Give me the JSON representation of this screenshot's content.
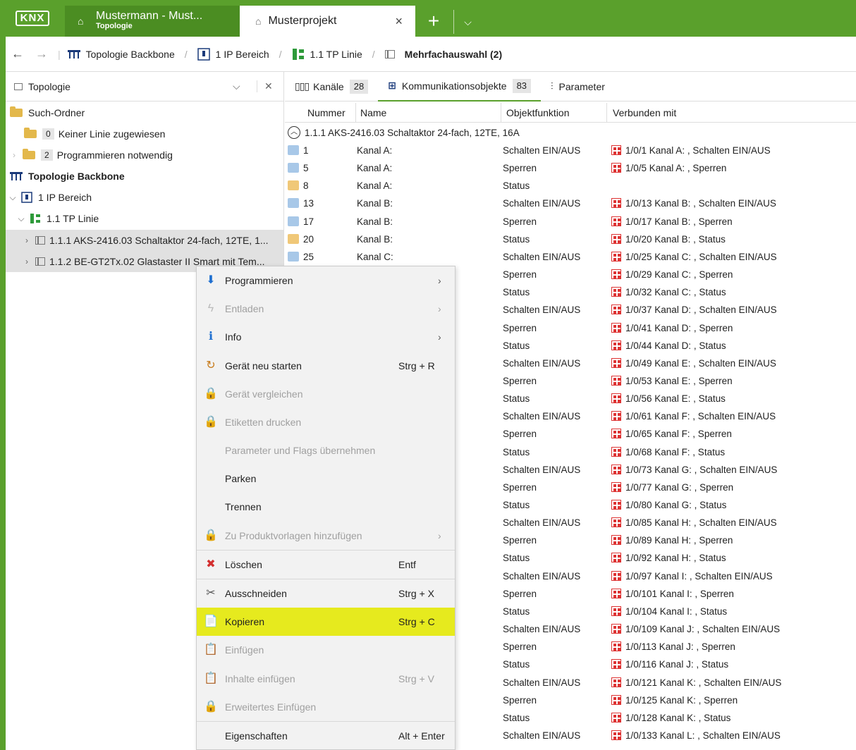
{
  "app": {
    "logo": "KNX",
    "tab1_title": "Mustermann - Must...",
    "tab1_sub": "Topologie",
    "tab2_title": "Musterprojekt",
    "tab2_close": "×",
    "new_tab": "+",
    "dropdown": "⌵"
  },
  "breadcrumb": {
    "back": "←",
    "forward": "→",
    "items": [
      "Topologie Backbone",
      "1 IP Bereich",
      "1.1 TP Linie",
      "Mehrfachauswahl (2)"
    ],
    "separator": "/"
  },
  "left": {
    "header": "Topologie",
    "chevron": "⌵",
    "close": "✕",
    "tree": [
      {
        "label": "Such-Ordner"
      },
      {
        "count": "0",
        "label": "Keiner Linie zugewiesen"
      },
      {
        "count": "2",
        "label": "Programmieren notwendig"
      },
      {
        "label": "Topologie Backbone"
      },
      {
        "label": "1 IP Bereich"
      },
      {
        "label": "1.1 TP Linie"
      },
      {
        "label": "1.1.1 AKS-2416.03 Schaltaktor 24-fach, 12TE, 1..."
      },
      {
        "label": "1.1.2 BE-GT2Tx.02 Glastaster II Smart mit Tem..."
      }
    ]
  },
  "right": {
    "tabs": [
      {
        "label": "Kanäle",
        "count": "28"
      },
      {
        "label": "Kommunikationsobjekte",
        "count": "83"
      },
      {
        "label": "Parameter"
      }
    ],
    "columns": [
      "Nummer",
      "Name",
      "Objektfunktion",
      "Verbunden mit"
    ],
    "group": "1.1.1 AKS-2416.03 Schaltaktor 24-fach, 12TE, 16A",
    "rows": [
      {
        "num": "1",
        "name": "Kanal A:",
        "func": "Schalten EIN/AUS",
        "conn": "1/0/1 Kanal A: , Schalten EIN/AUS"
      },
      {
        "num": "5",
        "name": "Kanal A:",
        "func": "Sperren",
        "conn": "1/0/5 Kanal A: , Sperren"
      },
      {
        "num": "8",
        "name": "Kanal A:",
        "func": "Status",
        "conn": ""
      },
      {
        "num": "13",
        "name": "Kanal B:",
        "func": "Schalten EIN/AUS",
        "conn": "1/0/13 Kanal B: , Schalten EIN/AUS"
      },
      {
        "num": "17",
        "name": "Kanal B:",
        "func": "Sperren",
        "conn": "1/0/17 Kanal B: , Sperren"
      },
      {
        "num": "20",
        "name": "Kanal B:",
        "func": "Status",
        "conn": "1/0/20 Kanal B: , Status"
      },
      {
        "num": "25",
        "name": "Kanal C:",
        "func": "Schalten EIN/AUS",
        "conn": "1/0/25 Kanal C: , Schalten EIN/AUS"
      },
      {
        "num": "",
        "name": "",
        "func": "Sperren",
        "conn": "1/0/29 Kanal C: , Sperren"
      },
      {
        "num": "",
        "name": "",
        "func": "Status",
        "conn": "1/0/32 Kanal C: , Status"
      },
      {
        "num": "",
        "name": "",
        "func": "Schalten EIN/AUS",
        "conn": "1/0/37 Kanal D: , Schalten EIN/AUS"
      },
      {
        "num": "",
        "name": "",
        "func": "Sperren",
        "conn": "1/0/41 Kanal D: , Sperren"
      },
      {
        "num": "",
        "name": "",
        "func": "Status",
        "conn": "1/0/44 Kanal D: , Status"
      },
      {
        "num": "",
        "name": "",
        "func": "Schalten EIN/AUS",
        "conn": "1/0/49 Kanal E: , Schalten EIN/AUS"
      },
      {
        "num": "",
        "name": "",
        "func": "Sperren",
        "conn": "1/0/53 Kanal E: , Sperren"
      },
      {
        "num": "",
        "name": "",
        "func": "Status",
        "conn": "1/0/56 Kanal E: , Status"
      },
      {
        "num": "",
        "name": "",
        "func": "Schalten EIN/AUS",
        "conn": "1/0/61 Kanal F: , Schalten EIN/AUS"
      },
      {
        "num": "",
        "name": "",
        "func": "Sperren",
        "conn": "1/0/65 Kanal F: , Sperren"
      },
      {
        "num": "",
        "name": "",
        "func": "Status",
        "conn": "1/0/68 Kanal F: , Status"
      },
      {
        "num": "",
        "name": "",
        "func": "Schalten EIN/AUS",
        "conn": "1/0/73 Kanal G: , Schalten EIN/AUS"
      },
      {
        "num": "",
        "name": "",
        "func": "Sperren",
        "conn": "1/0/77 Kanal G: , Sperren"
      },
      {
        "num": "",
        "name": "",
        "func": "Status",
        "conn": "1/0/80 Kanal G: , Status"
      },
      {
        "num": "",
        "name": "",
        "func": "Schalten EIN/AUS",
        "conn": "1/0/85 Kanal H: , Schalten EIN/AUS"
      },
      {
        "num": "",
        "name": "",
        "func": "Sperren",
        "conn": "1/0/89 Kanal H: , Sperren"
      },
      {
        "num": "",
        "name": "",
        "func": "Status",
        "conn": "1/0/92 Kanal H: , Status"
      },
      {
        "num": "",
        "name": "",
        "func": "Schalten EIN/AUS",
        "conn": "1/0/97 Kanal I: , Schalten EIN/AUS"
      },
      {
        "num": "",
        "name": "",
        "func": "Sperren",
        "conn": "1/0/101 Kanal I: , Sperren"
      },
      {
        "num": "",
        "name": "",
        "func": "Status",
        "conn": "1/0/104 Kanal I: , Status"
      },
      {
        "num": "",
        "name": "",
        "func": "Schalten EIN/AUS",
        "conn": "1/0/109 Kanal J: , Schalten EIN/AUS"
      },
      {
        "num": "",
        "name": "",
        "func": "Sperren",
        "conn": "1/0/113 Kanal J: , Sperren"
      },
      {
        "num": "",
        "name": "",
        "func": "Status",
        "conn": "1/0/116 Kanal J: , Status"
      },
      {
        "num": "",
        "name": "",
        "func": "Schalten EIN/AUS",
        "conn": "1/0/121 Kanal K: , Schalten EIN/AUS"
      },
      {
        "num": "",
        "name": "",
        "func": "Sperren",
        "conn": "1/0/125 Kanal K: , Sperren"
      },
      {
        "num": "",
        "name": "",
        "func": "Status",
        "conn": "1/0/128 Kanal K: , Status"
      },
      {
        "num": "",
        "name": "",
        "func": "Schalten EIN/AUS",
        "conn": "1/0/133 Kanal L: , Schalten EIN/AUS"
      }
    ]
  },
  "menu": {
    "items": [
      {
        "label": "Programmieren",
        "shortcut": "",
        "arrow": "›"
      },
      {
        "label": "Entladen",
        "shortcut": "",
        "arrow": "›"
      },
      {
        "label": "Info",
        "shortcut": "",
        "arrow": "›"
      },
      {
        "label": "Gerät neu starten",
        "shortcut": "Strg + R",
        "arrow": ""
      },
      {
        "label": "Gerät vergleichen",
        "shortcut": "",
        "arrow": ""
      },
      {
        "label": "Etiketten drucken",
        "shortcut": "",
        "arrow": ""
      },
      {
        "label": "Parameter und Flags übernehmen",
        "shortcut": "",
        "arrow": ""
      },
      {
        "label": "Parken",
        "shortcut": "",
        "arrow": ""
      },
      {
        "label": "Trennen",
        "shortcut": "",
        "arrow": ""
      },
      {
        "label": "Zu Produktvorlagen hinzufügen",
        "shortcut": "",
        "arrow": "›"
      },
      {
        "label": "Löschen",
        "shortcut": "Entf",
        "arrow": ""
      },
      {
        "label": "Ausschneiden",
        "shortcut": "Strg + X",
        "arrow": ""
      },
      {
        "label": "Kopieren",
        "shortcut": "Strg + C",
        "arrow": ""
      },
      {
        "label": "Einfügen",
        "shortcut": "",
        "arrow": ""
      },
      {
        "label": "Inhalte einfügen",
        "shortcut": "Strg + V",
        "arrow": ""
      },
      {
        "label": "Erweitertes Einfügen",
        "shortcut": "",
        "arrow": ""
      },
      {
        "label": "Eigenschaften",
        "shortcut": "Alt + Enter",
        "arrow": ""
      }
    ]
  },
  "colors": {
    "accent": "#5aa02c",
    "highlight": "#e6ea1e",
    "link_icon": "#d33333"
  }
}
